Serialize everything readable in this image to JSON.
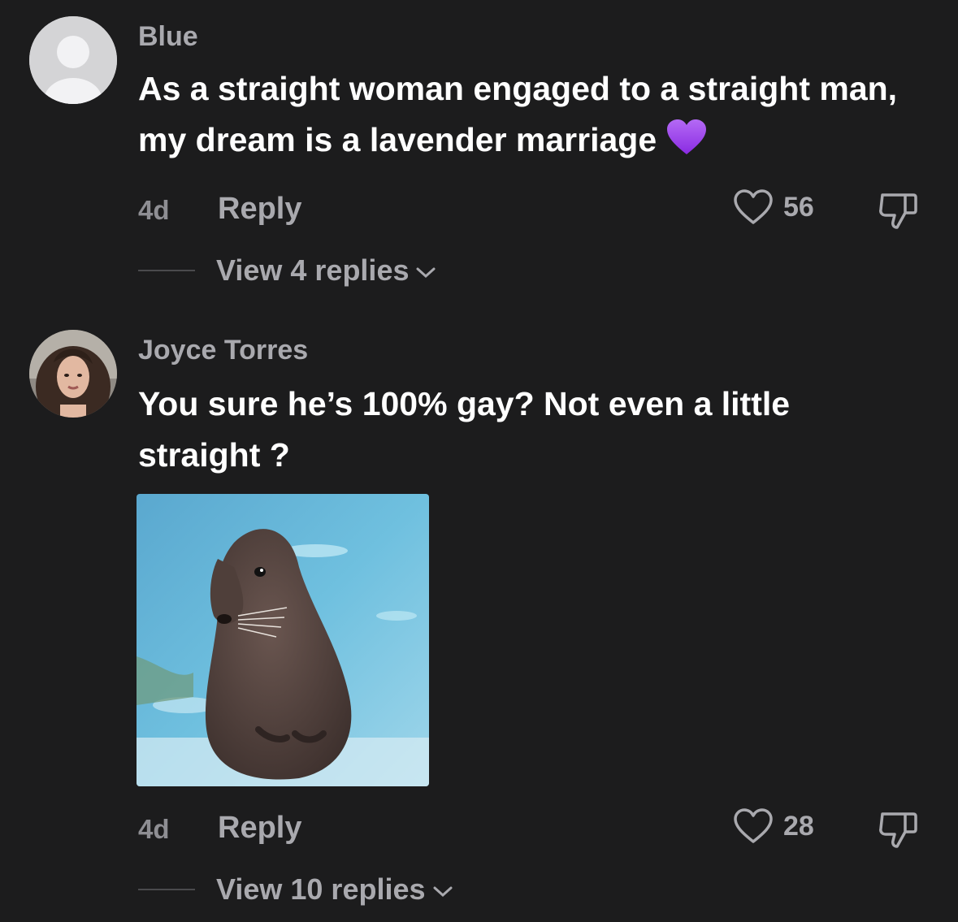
{
  "comments": [
    {
      "username": "Blue",
      "text": "As a straight woman engaged to a straight man, my dream is a lavender marriage",
      "emoji": "purple-heart",
      "time": "4d",
      "reply_label": "Reply",
      "likes": "56",
      "view_replies": "View 4 replies",
      "avatar": "default-avatar-icon"
    },
    {
      "username": "Joyce Torres",
      "text": "You sure he’s 100% gay? Not even a little straight ?",
      "time": "4d",
      "reply_label": "Reply",
      "likes": "28",
      "view_replies": "View 10 replies",
      "avatar": "profile-photo",
      "attachment": "seal-gif"
    }
  ],
  "colors": {
    "background": "#1c1c1d",
    "text_primary": "#ffffff",
    "text_secondary": "#a9a9ae",
    "emoji_purple": "#9b3ff0"
  }
}
